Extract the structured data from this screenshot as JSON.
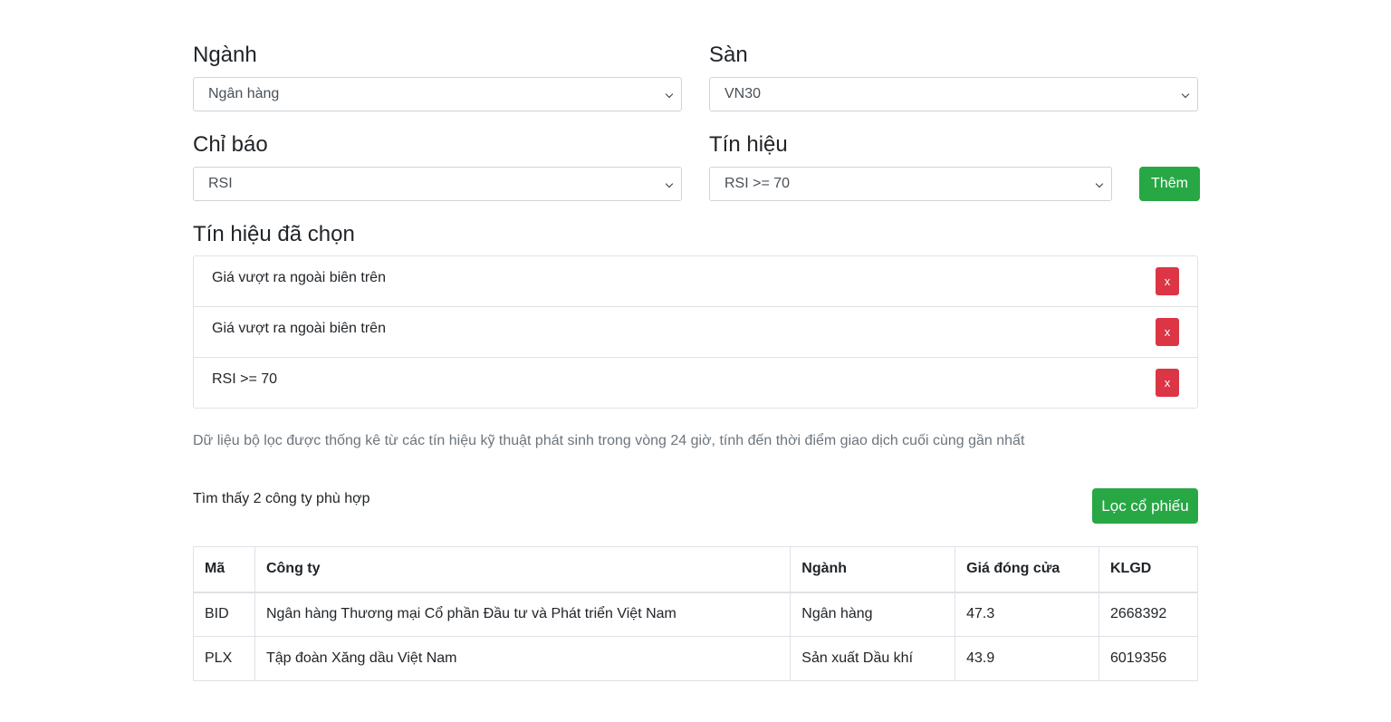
{
  "filters": {
    "industry": {
      "label": "Ngành",
      "selected": "Ngân hàng"
    },
    "exchange": {
      "label": "Sàn",
      "selected": "VN30"
    },
    "indicator": {
      "label": "Chỉ báo",
      "selected": "RSI"
    },
    "signal": {
      "label": "Tín hiệu",
      "selected": "RSI >= 70"
    },
    "add_button": "Thêm"
  },
  "selected_signals": {
    "title": "Tín hiệu đã chọn",
    "items": [
      {
        "text": "Giá vượt ra ngoài biên trên",
        "remove": "x"
      },
      {
        "text": "Giá vượt ra ngoài biên trên",
        "remove": "x"
      },
      {
        "text": "RSI >= 70",
        "remove": "x"
      }
    ]
  },
  "note": "Dữ liệu bộ lọc được thống kê từ các tín hiệu kỹ thuật phát sinh trong vòng 24 giờ, tính đến thời điểm giao dịch cuối cùng gần nhất",
  "results": {
    "found_text": "Tìm thấy 2 công ty phù hợp",
    "filter_button": "Lọc cổ phiếu",
    "columns": [
      "Mã",
      "Công ty",
      "Ngành",
      "Giá đóng cửa",
      "KLGD"
    ],
    "rows": [
      [
        "BID",
        "Ngân hàng Thương mại Cổ phần Đầu tư và Phát triển Việt Nam",
        "Ngân hàng",
        "47.3",
        "2668392"
      ],
      [
        "PLX",
        "Tập đoàn Xăng dầu Việt Nam",
        "Sản xuất Dầu khí",
        "43.9",
        "6019356"
      ]
    ]
  },
  "colors": {
    "success": "#28a745",
    "danger": "#dc3545",
    "muted": "#6c757d"
  }
}
